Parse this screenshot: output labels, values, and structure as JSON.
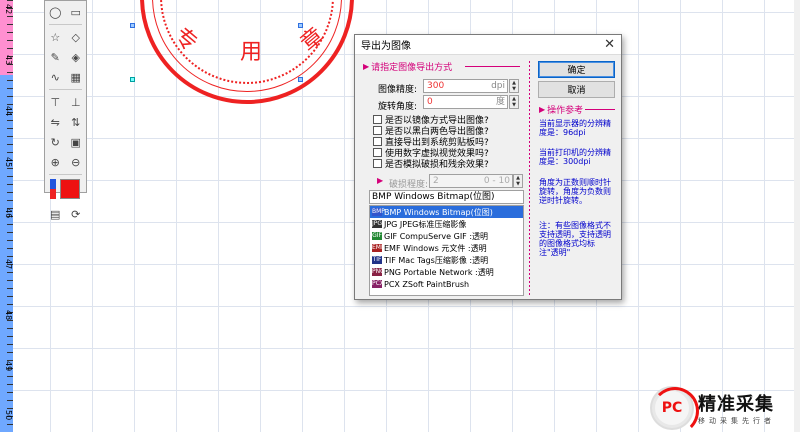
{
  "ruler": {
    "ticks": [
      "42",
      "43",
      "44",
      "45",
      "46",
      "47",
      "48",
      "49",
      "50"
    ]
  },
  "seal": {
    "chars": [
      "专",
      "用",
      "章"
    ]
  },
  "dialog": {
    "title": "导出为图像",
    "close_glyph": "✕",
    "section_export": "请指定图像导出方式",
    "precision_label": "图像精度:",
    "precision_value": "300",
    "precision_unit": "dpi",
    "rotation_label": "旋转角度:",
    "rotation_value": "0",
    "rotation_unit": "度",
    "checkboxes": [
      "是否以镜像方式导出图像?",
      "是否以黑白两色导出图像?",
      "直接导出到系统剪贴板吗?",
      "使用数字虚拟视觉效果吗?",
      "是否模拟破损和残余效果?"
    ],
    "damage_label": "破损程度:",
    "damage_value": "2",
    "damage_range": "0 - 10",
    "format_selected": "BMP Windows Bitmap(位图)",
    "formats": [
      {
        "icon": "BMP",
        "label": "BMP Windows Bitmap(位图)",
        "color": "#3355cc"
      },
      {
        "icon": "JPG",
        "label": "JPG JPEG标准压缩影像",
        "color": "#333333"
      },
      {
        "icon": "GIF",
        "label": "GIF CompuServe GIF :透明",
        "color": "#228833"
      },
      {
        "icon": "EMF",
        "label": "EMF Windows 元文件 :透明",
        "color": "#aa2222"
      },
      {
        "icon": "TIF",
        "label": "TIF Mac Tags压缩影像 :透明",
        "color": "#223388"
      },
      {
        "icon": "PNG",
        "label": "PNG Portable Network :透明",
        "color": "#882244"
      },
      {
        "icon": "PCX",
        "label": "PCX ZSoft PaintBrush",
        "color": "#882266"
      }
    ],
    "ok_label": "确定",
    "cancel_label": "取消",
    "section_ops": "操作参考",
    "info": {
      "screen_res": "当前显示器的分辨精度是：96dpi",
      "printer_res": "当前打印机的分辨精度是：300dpi",
      "rotation_tip": "角度为正数则顺时针旋转，角度为负数则逆时针旋转。",
      "note": "注：有些图像格式不支持透明，支持透明的图像格式均标注\"透明\""
    }
  },
  "logo": {
    "mark_text": "PC",
    "title": "精准采集",
    "subtitle": "移动采集先行者"
  },
  "colors": {
    "accent_magenta": "#d4007a",
    "seal_red": "#ee2222",
    "selection_blue": "#2a6ddc",
    "info_blue": "#0000cc"
  }
}
